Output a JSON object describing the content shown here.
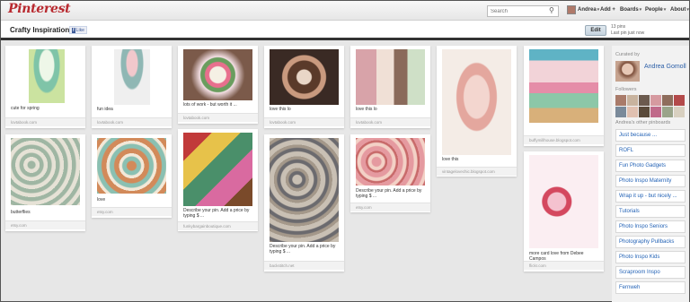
{
  "topbar": {
    "logo": "Pinterest",
    "search_placeholder": "Search",
    "nav": [
      "Andrea",
      "Add +",
      "Boards",
      "People",
      "About"
    ]
  },
  "board": {
    "title": "Crafty Inspiration",
    "like_label": "Like",
    "edit_label": "Edit",
    "pins_count": "13 pins",
    "last_pin": "Last pin just now"
  },
  "pins": [
    {
      "desc": "cute for spring",
      "src": "lovtabook.com"
    },
    {
      "desc": "fun idea",
      "src": "lovtabook.com"
    },
    {
      "desc": "lots of work - but worth it ...",
      "src": "lovtabook.com"
    },
    {
      "desc": "love this lo",
      "src": "lovtabook.com"
    },
    {
      "desc": "love this lo",
      "src": "lovtabook.com"
    },
    {
      "desc": "love this",
      "src": "vintagelovechic.blogspot.com"
    },
    {
      "desc": "",
      "src": "buffymillhouse.blogspot.com"
    },
    {
      "desc": "butterflies",
      "src": "etsy.com"
    },
    {
      "desc": "love",
      "src": "etsy.com"
    },
    {
      "desc": "Describe your pin. Add a price by typing $ ...",
      "src": "funkybargainboutique.com"
    },
    {
      "desc": "Describe your pin. Add a price by typing $ ...",
      "src": "backstitch.net"
    },
    {
      "desc": "Describe your pin. Add a price by typing $ ...",
      "src": "etsy.com"
    },
    {
      "desc": "more card love from Debee Campos",
      "src": "flickr.com"
    }
  ],
  "sidebar": {
    "curated_by": "Curated by",
    "curator_name": "Andrea Gomoll",
    "followers_label": "Followers",
    "other_boards_label": "Andrea's other pinboards",
    "boards": [
      "Just because ...",
      "ROFL",
      "Fun Photo Gadgets",
      "Photo Inspo Maternity",
      "Wrap it up - but nicely ...",
      "Tutorials",
      "Photo Inspo Seniors",
      "Photography Pullbacks",
      "Photo Inspo Kids",
      "Scraproom Inspo",
      "Fernweh"
    ]
  },
  "colors": {
    "logo_red": "#b8292f",
    "link_blue": "#2463b6",
    "background": "#e7e7e7"
  }
}
